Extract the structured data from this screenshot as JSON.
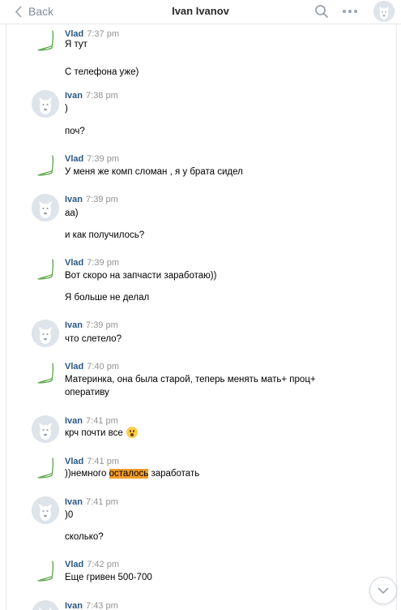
{
  "header": {
    "back_label": "Back",
    "title": "Ivan Ivanov"
  },
  "messages": [
    {
      "author": "Vlad",
      "time": "7:37 pm",
      "lines": [
        "Я тут",
        "С телефона уже)"
      ]
    },
    {
      "author": "Ivan",
      "time": "7:38 pm",
      "lines": [
        ")",
        "поч?"
      ]
    },
    {
      "author": "Vlad",
      "time": "7:39 pm",
      "lines": [
        "У меня же комп сломан , я у брата сидел"
      ]
    },
    {
      "author": "Ivan",
      "time": "7:39 pm",
      "lines": [
        "аа)",
        "и как получилось?"
      ]
    },
    {
      "author": "Vlad",
      "time": "7:39 pm",
      "lines": [
        "Вот скоро на запчасти заработаю))",
        "Я больше не делал"
      ]
    },
    {
      "author": "Ivan",
      "time": "7:39 pm",
      "lines": [
        "что слетело?"
      ]
    },
    {
      "author": "Vlad",
      "time": "7:40 pm",
      "lines": [
        "Материнка, она была старой, теперь менять мать+ проц+",
        "оперативу"
      ]
    },
    {
      "author": "Ivan",
      "time": "7:41 pm",
      "lines": [
        "крч почти все"
      ]
    },
    {
      "author": "Vlad",
      "time": "7:41 pm",
      "lines": [
        "))немного",
        "осталось",
        "заработать"
      ]
    },
    {
      "author": "Ivan",
      "time": "7:41 pm",
      "lines": [
        ")0",
        "сколько?"
      ]
    },
    {
      "author": "Vlad",
      "time": "7:42 pm",
      "lines": [
        "Еще гривен 500-700"
      ]
    },
    {
      "author": "Ivan",
      "time": "7:43 pm",
      "lines": []
    }
  ],
  "icons": {
    "back": "chevron-left-icon",
    "search": "search-icon",
    "more": "more-dots-icon",
    "scroll": "chevron-down-icon",
    "emoji": "astonished-face-emoji"
  },
  "colors": {
    "name": "#2a5885",
    "time": "#939393",
    "highlight": "#f39c2b"
  }
}
